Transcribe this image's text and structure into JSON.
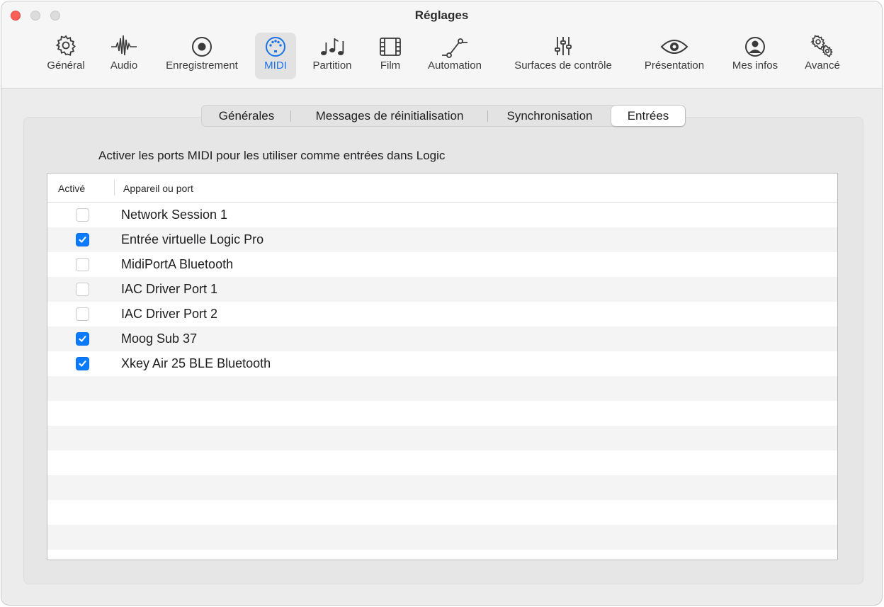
{
  "window": {
    "title": "Réglages"
  },
  "toolbar": {
    "items": [
      {
        "label": "Général",
        "icon": "gear-icon"
      },
      {
        "label": "Audio",
        "icon": "waveform-icon"
      },
      {
        "label": "Enregistrement",
        "icon": "record-icon"
      },
      {
        "label": "MIDI",
        "icon": "midi-port-icon",
        "selected": true
      },
      {
        "label": "Partition",
        "icon": "music-notes-icon"
      },
      {
        "label": "Film",
        "icon": "film-icon"
      },
      {
        "label": "Automation",
        "icon": "automation-curve-icon"
      },
      {
        "label": "Surfaces de contrôle",
        "icon": "sliders-icon"
      },
      {
        "label": "Présentation",
        "icon": "eye-icon"
      },
      {
        "label": "Mes infos",
        "icon": "person-icon"
      },
      {
        "label": "Avancé",
        "icon": "gears-icon"
      }
    ]
  },
  "tabs": [
    {
      "label": "Générales"
    },
    {
      "label": "Messages de réinitialisation"
    },
    {
      "label": "Synchronisation"
    },
    {
      "label": "Entrées",
      "active": true
    }
  ],
  "heading": "Activer les ports MIDI pour les utiliser comme entrées dans Logic",
  "table": {
    "columns": [
      "Activé",
      "Appareil ou port"
    ],
    "rows": [
      {
        "enabled": false,
        "name": "Network Session 1"
      },
      {
        "enabled": true,
        "name": "Entrée virtuelle Logic Pro"
      },
      {
        "enabled": false,
        "name": "MidiPortA Bluetooth"
      },
      {
        "enabled": false,
        "name": "IAC Driver Port 1"
      },
      {
        "enabled": false,
        "name": "IAC Driver Port 2"
      },
      {
        "enabled": true,
        "name": "Moog Sub 37"
      },
      {
        "enabled": true,
        "name": "Xkey Air 25 BLE Bluetooth"
      }
    ]
  },
  "colors": {
    "accent": "#0a7aff",
    "close": "#fe5f57",
    "selected_label": "#1a73e8"
  }
}
